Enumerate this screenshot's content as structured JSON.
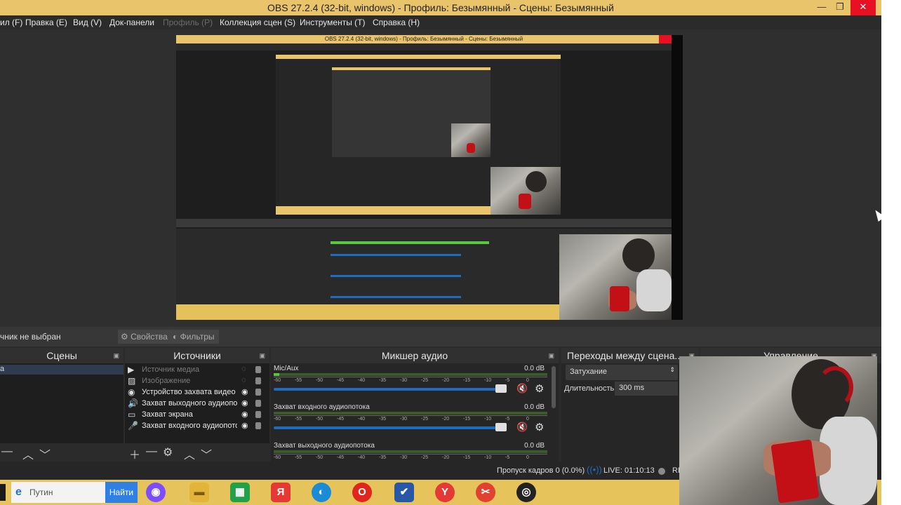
{
  "window": {
    "title": "OBS 27.2.4 (32-bit, windows) - Профиль: Безымянный - Сцены: Безымянный",
    "minimize": "—",
    "restore": "❐",
    "close": "✕"
  },
  "menu": [
    {
      "label": "ил (F)",
      "disabled": false
    },
    {
      "label": "Правка (E)",
      "disabled": false
    },
    {
      "label": "Вид (V)",
      "disabled": false
    },
    {
      "label": "Док-панели",
      "disabled": false
    },
    {
      "label": "Профиль (P)",
      "disabled": true
    },
    {
      "label": "Коллекция сцен (S)",
      "disabled": false
    },
    {
      "label": "Инструменты (T)",
      "disabled": false
    },
    {
      "label": "Справка (H)",
      "disabled": false
    }
  ],
  "preview": {
    "nested_title": "OBS 27.2.4 (32-bit, windows) - Профиль: Безымянный - Сцены: Безымянный"
  },
  "filterbar": {
    "no_source": "чник не выбран",
    "properties": "Свойства",
    "filters": "Фильтры"
  },
  "scenes": {
    "title": "Сцены",
    "item": "а"
  },
  "sources": {
    "title": "Источники",
    "items": [
      {
        "label": "Источник медиа",
        "icon": "▶",
        "visible": false
      },
      {
        "label": "Изображение",
        "icon": "▨",
        "visible": false
      },
      {
        "label": "Устройство захвата видео",
        "icon": "◉",
        "visible": true
      },
      {
        "label": "Захват выходного аудиопот",
        "icon": "🔊",
        "visible": true
      },
      {
        "label": "Захват экрана",
        "icon": "▭",
        "visible": true
      },
      {
        "label": "Захват входного аудиопото",
        "icon": "🎤",
        "visible": true
      }
    ]
  },
  "mixer": {
    "title": "Микшер аудио",
    "ticks": [
      "-60",
      "-55",
      "-50",
      "-45",
      "-40",
      "-35",
      "-30",
      "-25",
      "-20",
      "-15",
      "-10",
      "-5",
      "0"
    ],
    "channels": [
      {
        "name": "Mic/Aux",
        "db": "0.0 dB",
        "level": 0.02
      },
      {
        "name": "Захват входного аудиопотока",
        "db": "0.0 dB",
        "level": 0.0
      },
      {
        "name": "Захват выходного аудиопотока",
        "db": "0.0 dB",
        "level": 0.0
      }
    ]
  },
  "transitions": {
    "title": "Переходы между сцена...",
    "selected": "Затухание",
    "duration_label": "Длительность",
    "duration_value": "300 ms"
  },
  "controls": {
    "title": "Управление"
  },
  "status": {
    "dropped": "Пропуск кадров 0 (0.0%)",
    "live": "LIVE: 01:10:13",
    "rec": "RE"
  },
  "taskbar": {
    "search_placeholder": "Путин",
    "find_button": "Найти",
    "apps": [
      {
        "name": "alice-icon",
        "color": "#7b4dff",
        "glyph": "◉"
      },
      {
        "name": "folder-icon",
        "color": "#e2b53a",
        "glyph": "▬"
      },
      {
        "name": "store-icon",
        "color": "#22a04a",
        "glyph": "▦"
      },
      {
        "name": "yandex-icon",
        "color": "#e53935",
        "glyph": "Я"
      },
      {
        "name": "edge-icon",
        "color": "#1c8bd6",
        "glyph": "◐"
      },
      {
        "name": "opera-icon",
        "color": "#e0261c",
        "glyph": "O"
      },
      {
        "name": "shield-icon",
        "color": "#2857a6",
        "glyph": "✔"
      },
      {
        "name": "yandex-browser-icon",
        "color": "#e53935",
        "glyph": "Y"
      },
      {
        "name": "cutter-icon",
        "color": "#e2412f",
        "glyph": "✂"
      },
      {
        "name": "obs-icon",
        "color": "#222222",
        "glyph": "◎"
      }
    ]
  }
}
